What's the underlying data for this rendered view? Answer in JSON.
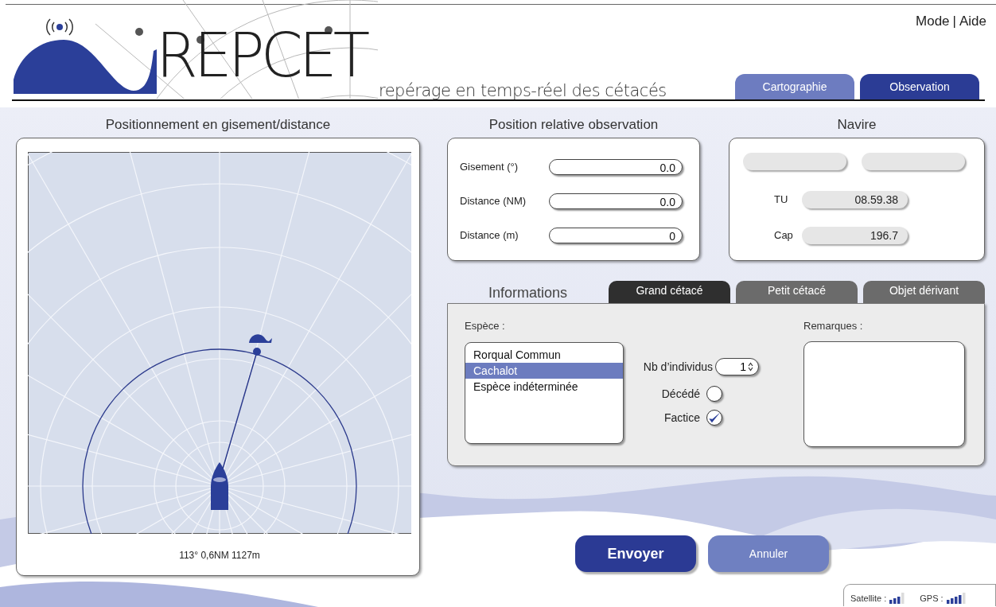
{
  "header": {
    "logo_text": "REPCET",
    "tagline": "repérage en temps-réel des cétacés",
    "menu": [
      {
        "label": "Mode"
      },
      {
        "label": "Aide"
      }
    ],
    "menu_separator": "|",
    "mode_tabs": [
      {
        "label": "Cartographie",
        "selected": false
      },
      {
        "label": "Observation",
        "selected": true
      }
    ]
  },
  "radar": {
    "title": "Positionnement en gisement/distance",
    "caption": "113° 0,6NM 1127m"
  },
  "position": {
    "title": "Position relative observation",
    "fields": [
      {
        "label": "Gisement (°)",
        "value": "0.0"
      },
      {
        "label": "Distance (NM)",
        "value": "0.0"
      },
      {
        "label": "Distance (m)",
        "value": "0"
      }
    ]
  },
  "navire": {
    "title": "Navire",
    "fields": [
      {
        "label": "TU",
        "value": "08.59.38"
      },
      {
        "label": "Cap",
        "value": "196.7"
      }
    ]
  },
  "informations": {
    "title": "Informations",
    "tabs": [
      {
        "label": "Grand cétacé",
        "selected": true
      },
      {
        "label": "Petit cétacé",
        "selected": false
      },
      {
        "label": "Objet dérivant",
        "selected": false
      }
    ],
    "species_label": "Espèce :",
    "species": [
      {
        "label": "Rorqual Commun",
        "selected": false
      },
      {
        "label": "Cachalot",
        "selected": true
      },
      {
        "label": "Espèce indéterminée",
        "selected": false
      }
    ],
    "count": {
      "label": "Nb d’individus",
      "value": "1"
    },
    "checks": [
      {
        "label": "Décédé",
        "checked": false
      },
      {
        "label": "Factice",
        "checked": true
      }
    ],
    "remarks_label": "Remarques :"
  },
  "actions": [
    {
      "label": "Envoyer",
      "kind": "primary"
    },
    {
      "label": "Annuler",
      "kind": "secondary"
    }
  ],
  "status": [
    {
      "label": "Satellite :"
    },
    {
      "label": "GPS :"
    }
  ]
}
